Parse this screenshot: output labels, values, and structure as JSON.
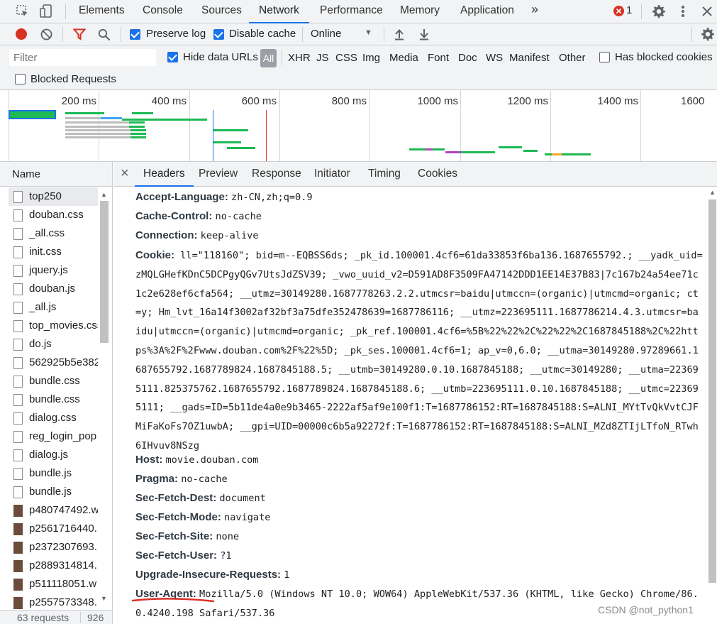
{
  "top_tabs": [
    "Elements",
    "Console",
    "Sources",
    "Network",
    "Performance",
    "Memory",
    "Application"
  ],
  "top_more": "»",
  "error_count": "1",
  "toolbar": {
    "preserve_log": "Preserve log",
    "disable_cache": "Disable cache",
    "throttle": "Online",
    "throttle_arrow": "▼"
  },
  "filter": {
    "placeholder": "Filter",
    "hide_data_urls": "Hide data URLs",
    "types": [
      "All",
      "XHR",
      "JS",
      "CSS",
      "Img",
      "Media",
      "Font",
      "Doc",
      "WS",
      "Manifest",
      "Other"
    ],
    "has_blocked_cookies": "Has blocked cookies",
    "blocked_requests": "Blocked Requests"
  },
  "timeline_ticks": [
    "200 ms",
    "400 ms",
    "600 ms",
    "800 ms",
    "1000 ms",
    "1200 ms",
    "1400 ms",
    "1600"
  ],
  "name_header": "Name",
  "requests": [
    {
      "name": "top250",
      "type": "doc"
    },
    {
      "name": "douban.css",
      "type": "doc"
    },
    {
      "name": "_all.css",
      "type": "doc"
    },
    {
      "name": "init.css",
      "type": "doc"
    },
    {
      "name": "jquery.js",
      "type": "doc"
    },
    {
      "name": "douban.js",
      "type": "doc"
    },
    {
      "name": "_all.js",
      "type": "doc"
    },
    {
      "name": "top_movies.css",
      "type": "doc"
    },
    {
      "name": "do.js",
      "type": "doc"
    },
    {
      "name": "562925b5e382",
      "type": "doc"
    },
    {
      "name": "bundle.css",
      "type": "doc"
    },
    {
      "name": "bundle.css",
      "type": "doc"
    },
    {
      "name": "dialog.css",
      "type": "doc"
    },
    {
      "name": "reg_login_pop",
      "type": "doc"
    },
    {
      "name": "dialog.js",
      "type": "doc"
    },
    {
      "name": "bundle.js",
      "type": "doc"
    },
    {
      "name": "bundle.js",
      "type": "doc"
    },
    {
      "name": "p480747492.w",
      "type": "img"
    },
    {
      "name": "p2561716440.",
      "type": "img"
    },
    {
      "name": "p2372307693.",
      "type": "img"
    },
    {
      "name": "p2889314814.",
      "type": "img"
    },
    {
      "name": "p511118051.w",
      "type": "img"
    },
    {
      "name": "p2557573348.",
      "type": "img"
    }
  ],
  "status": {
    "requests": "63 requests",
    "size": "926"
  },
  "detail_tabs": [
    "Headers",
    "Preview",
    "Response",
    "Initiator",
    "Timing",
    "Cookies"
  ],
  "close_glyph": "×",
  "headers": {
    "accept_language": {
      "key": "Accept-Language:",
      "value": "zh-CN,zh;q=0.9"
    },
    "cache_control": {
      "key": "Cache-Control:",
      "value": "no-cache"
    },
    "connection": {
      "key": "Connection:",
      "value": "keep-alive"
    },
    "cookie_key": "Cookie:",
    "cookie_lines": [
      " ll=\"118160\"; bid=m--EQBSS6ds; _pk_id.100001.4cf6=61da33853f6ba136.1687655792.; __yadk_uid=",
      "zMQLGHefKDnC5DCPgyQGv7UtsJdZSV39; _vwo_uuid_v2=D591AD8F3509FA47142DDD1EE14E37B83|7c167b24a54ee71c",
      "1c2e628ef6cfa564; __utmz=30149280.1687778263.2.2.utmcsr=baidu|utmccn=(organic)|utmcmd=organic; ct",
      "=y; Hm_lvt_16a14f3002af32bf3a75dfe352478639=1687786116; __utmz=223695111.1687786214.4.3.utmcsr=ba",
      "idu|utmccn=(organic)|utmcmd=organic; _pk_ref.100001.4cf6=%5B%22%22%2C%22%22%2C1687845188%2C%22htt",
      "ps%3A%2F%2Fwww.douban.com%2F%22%5D; _pk_ses.100001.4cf6=1; ap_v=0,6.0; __utma=30149280.97289661.1",
      "687655792.1687789824.1687845188.5; __utmb=30149280.0.10.1687845188; __utmc=30149280; __utma=22369",
      "5111.825375762.1687655792.1687789824.1687845188.6; __utmb=223695111.0.10.1687845188; __utmc=22369",
      "5111; __gads=ID=5b11de4a0e9b3465-2222af5af9e100f1:T=1687786152:RT=1687845188:S=ALNI_MYtTvQkVvtCJF",
      "MiFaKoFs7OZ1uwbA; __gpi=UID=00000c6b5a92272f:T=1687786152:RT=1687845188:S=ALNI_MZd8ZTIjLTfoN_RTwh",
      "6IHvuv8NSzg"
    ],
    "host": {
      "key": "Host:",
      "value": "movie.douban.com"
    },
    "pragma": {
      "key": "Pragma:",
      "value": "no-cache"
    },
    "sec_fetch_dest": {
      "key": "Sec-Fetch-Dest:",
      "value": "document"
    },
    "sec_fetch_mode": {
      "key": "Sec-Fetch-Mode:",
      "value": "navigate"
    },
    "sec_fetch_site": {
      "key": "Sec-Fetch-Site:",
      "value": "none"
    },
    "sec_fetch_user": {
      "key": "Sec-Fetch-User:",
      "value": "?1"
    },
    "upgrade": {
      "key": "Upgrade-Insecure-Requests:",
      "value": "1"
    },
    "user_agent": {
      "key": "User-Agent:",
      "value": "Mozilla/5.0 (Windows NT 10.0; WOW64) AppleWebKit/537.36 (KHTML, like Gecko) Chrome/86.",
      "value2": "0.4240.198 Safari/537.36"
    }
  },
  "watermark": "CSDN @not_python1",
  "colors": {
    "accent": "#1a73e8",
    "record": "#d93025",
    "annotation": "#d93025",
    "bar_green": "#1db954"
  }
}
